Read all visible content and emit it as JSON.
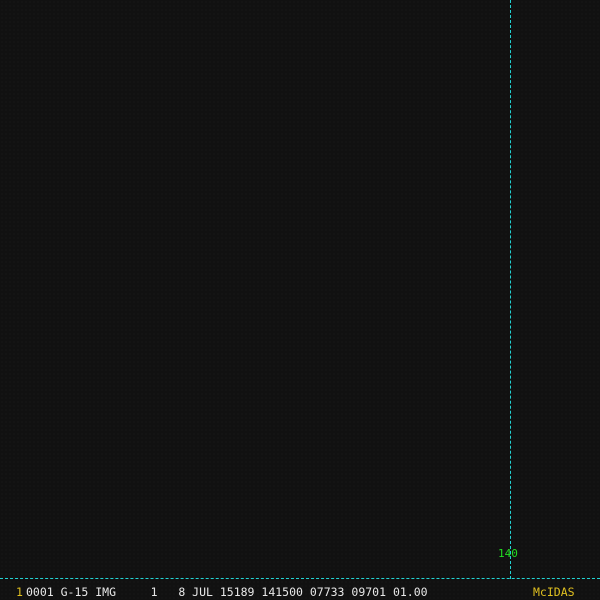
{
  "display": {
    "grid_line_color": "#22d3d3",
    "label_color": "#22dd22",
    "longitude_label": "140"
  },
  "status_bar": {
    "frame_number": "1",
    "image_info": "0001 G-15 IMG     1   8 JUL 15189 141500 07733 09701 01.00",
    "brand": "McIDAS"
  }
}
